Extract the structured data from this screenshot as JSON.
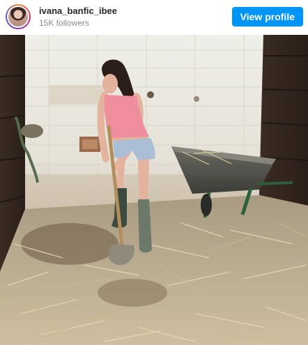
{
  "post_header": {
    "username": "ivana_banfic_ibee",
    "followers": "15K followers",
    "view_profile_label": "View profile"
  },
  "photo": {
    "description_icon": "stable-photo"
  },
  "colors": {
    "button_blue": "#0095f6",
    "username_text": "#262626",
    "secondary_text": "#8e8e8e"
  }
}
